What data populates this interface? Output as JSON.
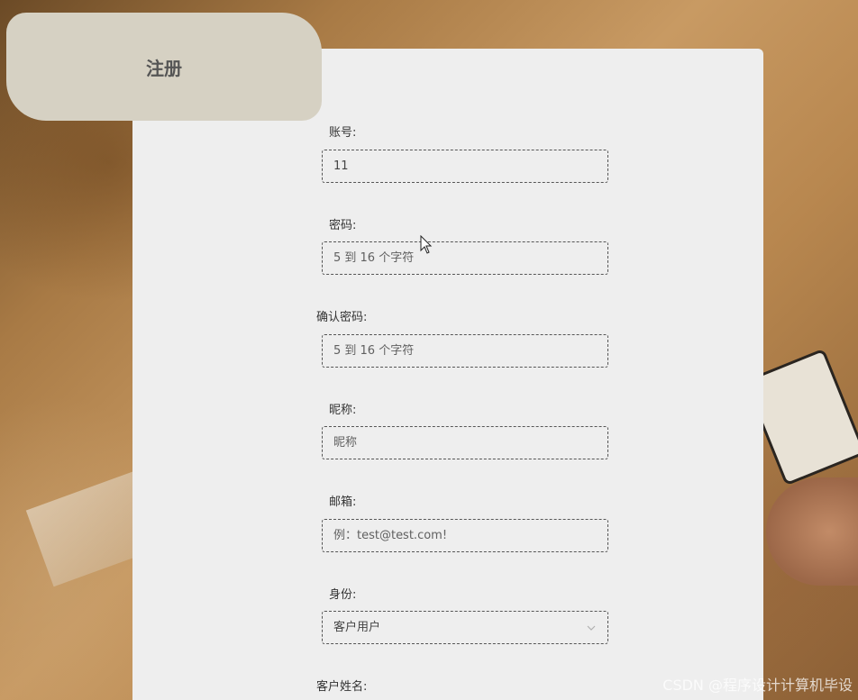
{
  "header": {
    "title": "注册"
  },
  "form": {
    "account": {
      "label": "账号:",
      "value": "11",
      "placeholder": ""
    },
    "password": {
      "label": "密码:",
      "value": "",
      "placeholder": "5 到 16 个字符"
    },
    "confirm_password": {
      "label": "确认密码:",
      "value": "",
      "placeholder": "5 到 16 个字符"
    },
    "nickname": {
      "label": "昵称:",
      "value": "",
      "placeholder": "昵称"
    },
    "email": {
      "label": "邮箱:",
      "value": "",
      "placeholder": "例：test@test.com!"
    },
    "identity": {
      "label": "身份:",
      "selected": "客户用户",
      "icon": "chevron-down-icon"
    },
    "customer_name": {
      "label": "客户姓名:"
    }
  },
  "watermark": "CSDN @程序设计计算机毕设",
  "colors": {
    "panel_bg": "#eeeeee",
    "title_tab_bg": "#d6d1c3",
    "title_text": "#555555",
    "field_border": "#555555"
  }
}
